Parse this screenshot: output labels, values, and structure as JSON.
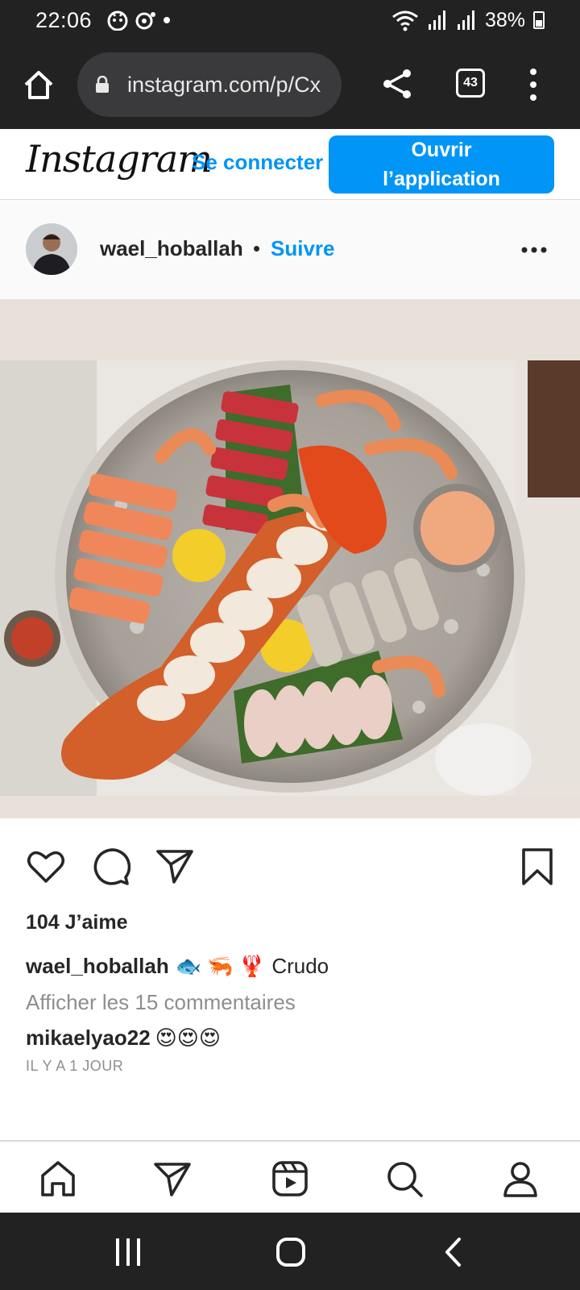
{
  "status_bar": {
    "time": "22:06",
    "battery": "38%"
  },
  "browser": {
    "url": "instagram.com/p/Cx",
    "tab_count": "43",
    "icons": [
      "home-icon",
      "lock-icon",
      "share-icon",
      "tabs-icon",
      "more-vert-icon"
    ]
  },
  "ig_header": {
    "logo": "Instagram",
    "connect_label": "Se connecter",
    "open_app_line1": "Ouvrir",
    "open_app_line2": "l’application",
    "accent_color": "#0095f6"
  },
  "post": {
    "username": "wael_hoballah",
    "separator": "•",
    "follow_label": "Suivre",
    "likes": "104 J’aime",
    "caption_user": "wael_hoballah",
    "caption_emojis": "🐟 🦐 🦞",
    "caption_text": "Crudo",
    "view_comments": "Afficher les 15 commentaires",
    "comment_user": "mikaelyao22",
    "comment_text": "😍😍😍",
    "time_ago": "IL Y A 1 JOUR"
  },
  "bottom_nav": [
    "home-icon",
    "direct-icon",
    "reels-icon",
    "search-icon",
    "profile-icon"
  ]
}
